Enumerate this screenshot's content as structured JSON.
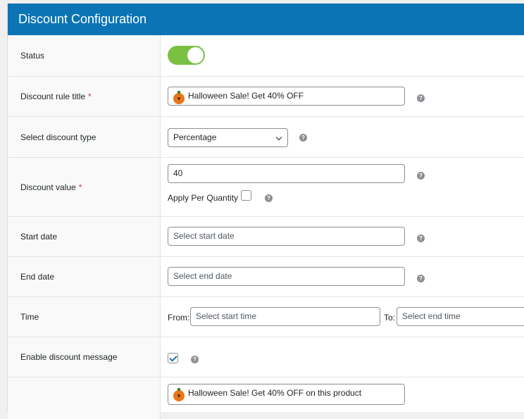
{
  "header": {
    "title": "Discount Configuration"
  },
  "rows": {
    "status": {
      "label": "Status",
      "enabled": true
    },
    "rule_title": {
      "label": "Discount rule title",
      "required_mark": "*",
      "value": "Halloween Sale! Get 40% OFF",
      "icon": "jack-o-lantern-emoji"
    },
    "discount_type": {
      "label": "Select discount type",
      "selected": "Percentage"
    },
    "discount_value": {
      "label": "Discount value",
      "required_mark": "*",
      "value": "40",
      "apply_per_quantity_label": "Apply Per Quantity",
      "apply_per_quantity_checked": false
    },
    "start_date": {
      "label": "Start date",
      "placeholder": "Select start date"
    },
    "end_date": {
      "label": "End date",
      "placeholder": "Select end date"
    },
    "time": {
      "label": "Time",
      "from_label": "From:",
      "from_placeholder": "Select start time",
      "to_label": "To:",
      "to_placeholder": "Select end time"
    },
    "enable_message": {
      "label": "Enable discount message",
      "checked": true
    },
    "message": {
      "value": "Halloween Sale! Get 40% OFF on this product",
      "icon": "jack-o-lantern-emoji"
    }
  },
  "help_icon_glyph": "?",
  "colors": {
    "header_bg": "#0a74b5",
    "toggle_on": "#7ac143",
    "required": "#d63638",
    "checkbox_check": "#2271b1"
  }
}
